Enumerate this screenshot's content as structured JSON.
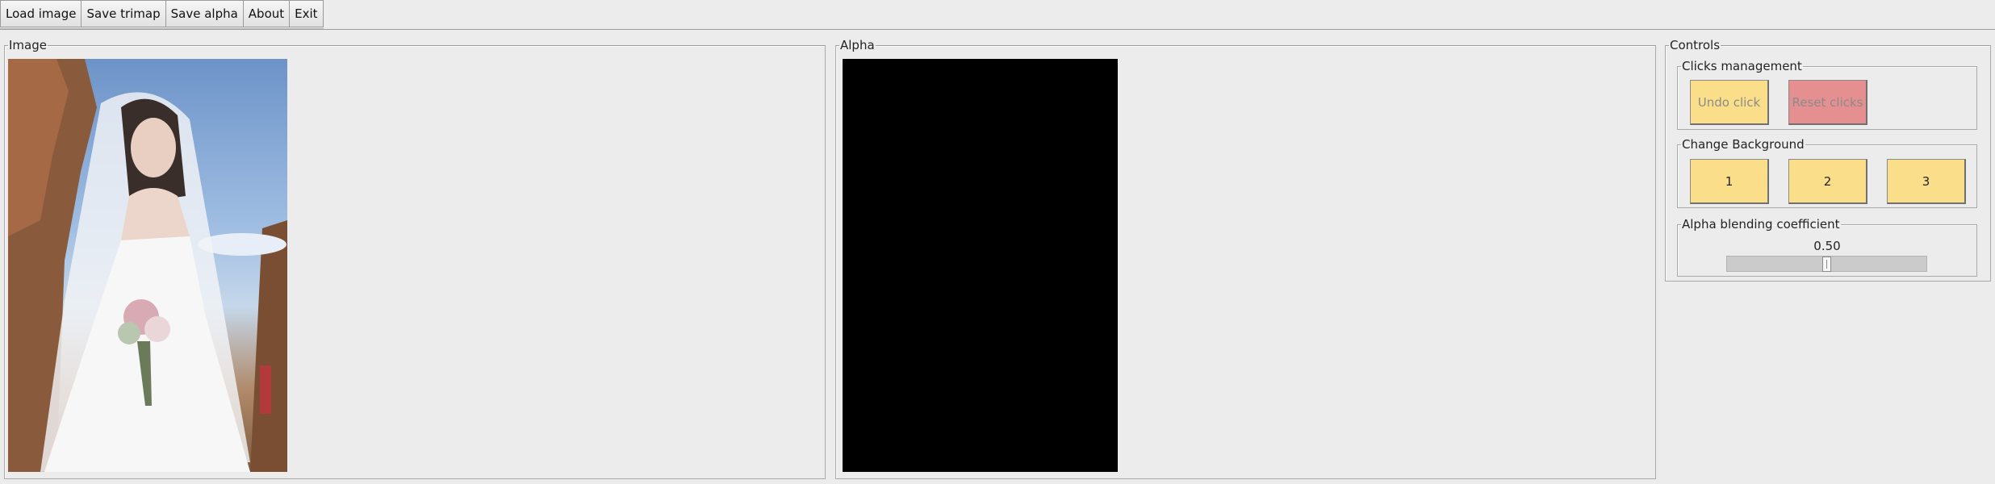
{
  "toolbar": {
    "load_image": "Load image",
    "save_trimap": "Save trimap",
    "save_alpha": "Save alpha",
    "about": "About",
    "exit": "Exit"
  },
  "image_panel": {
    "title": "Image"
  },
  "alpha_panel": {
    "title": "Alpha"
  },
  "controls": {
    "title": "Controls",
    "clicks": {
      "title": "Clicks management",
      "undo": "Undo click",
      "reset": "Reset clicks"
    },
    "background": {
      "title": "Change Background",
      "options": [
        "1",
        "2",
        "3"
      ]
    },
    "alpha_blend": {
      "title": "Alpha blending coefficient",
      "value_text": "0.50",
      "value": 0.5
    }
  },
  "colors": {
    "window_bg": "#ececec",
    "button_yellow": "#fbde8a",
    "button_red": "#e68f90",
    "alpha_canvas": "#000000"
  }
}
